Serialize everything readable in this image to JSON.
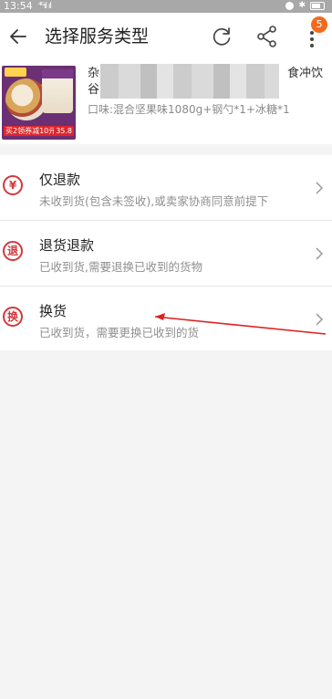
{
  "status_bar": {
    "time": "13:54",
    "signal": "⁴ᴳıl ıl"
  },
  "header": {
    "title": "选择服务类型",
    "badge_count": "5"
  },
  "product": {
    "title_left": "杂",
    "title_left_2": "谷",
    "title_right": "食冲饮",
    "spec": "口味:混合坚果味1080g+钢勺*1+冰糖*1",
    "image_promo_text": "买2领券减10元",
    "image_price_text": "35.8"
  },
  "options": [
    {
      "label": "仅退款",
      "icon_char": "¥",
      "icon_name": "refund-yen-icon",
      "desc": "未收到货(包含未签收),或卖家协商同意前提下"
    },
    {
      "label": "退货退款",
      "icon_char": "退",
      "icon_name": "return-icon",
      "desc": "已收到货,需要退换已收到的货物"
    },
    {
      "label": "换货",
      "icon_char": "换",
      "icon_name": "exchange-icon",
      "desc": "已收到货，需要更换已收到的货"
    }
  ],
  "colors": {
    "accent_red": "#d4373c",
    "badge_orange": "#f26b1d",
    "annotation_arrow": "#e02020"
  }
}
